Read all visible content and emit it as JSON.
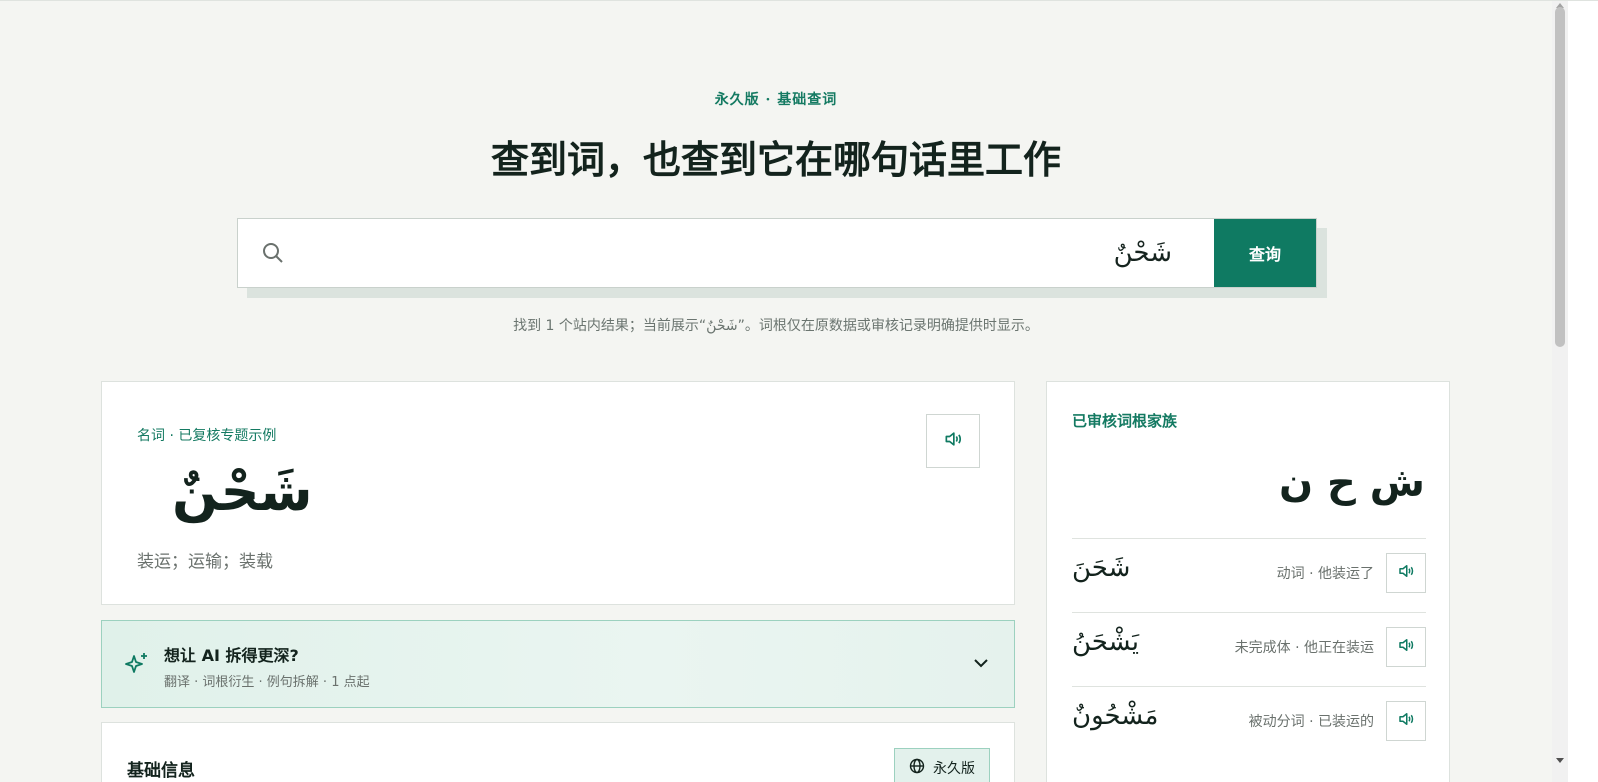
{
  "hero": {
    "eyebrow": "永久版 · 基础查词",
    "title": "查到词，也查到它在哪句话里工作"
  },
  "search": {
    "value": "شَحْنٌ",
    "button_label": "查询",
    "result_note": "找到 1 个站内结果；当前展示“شَحْنٌ”。词根仅在原数据或审核记录明确提供时显示。"
  },
  "word_card": {
    "meta": "名词 · 已复核专题示例",
    "arabic": "شَحْنٌ",
    "gloss": "装运；运输；装载"
  },
  "ai_card": {
    "title": "想让 AI 拆得更深?",
    "subtitle": "翻译 · 词根衍生 · 例句拆解 · 1 点起"
  },
  "basic_info": {
    "title": "基础信息",
    "badge": "永久版"
  },
  "root_family": {
    "heading": "已审核词根家族",
    "letters": "ش ح ن",
    "items": [
      {
        "arabic": "شَحَنَ",
        "desc": "动词 · 他装运了"
      },
      {
        "arabic": "يَشْحَنُ",
        "desc": "未完成体 · 他正在装运"
      },
      {
        "arabic": "مَشْحُونٌ",
        "desc": "被动分词 · 已装运的"
      }
    ]
  },
  "icons": {
    "search": "search-icon",
    "speaker": "speaker-icon",
    "sparkle": "sparkle-icon",
    "chevron": "chevron-down-icon",
    "globe": "globe-icon"
  },
  "colors": {
    "accent": "#0f7a62",
    "background": "#f4f5f2",
    "ai_border": "#9cd1bf"
  }
}
